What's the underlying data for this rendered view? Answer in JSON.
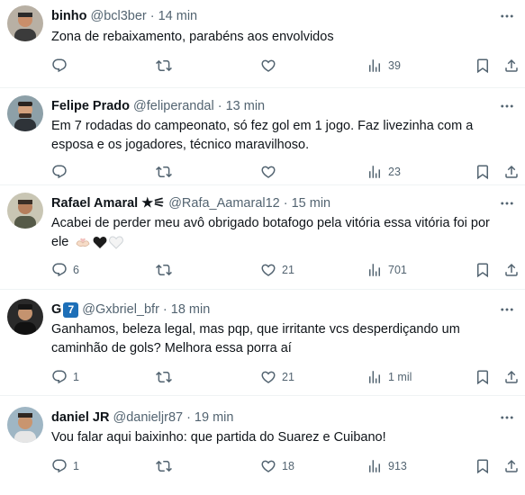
{
  "tweets": [
    {
      "display_name": "binho",
      "handle": "@bcl3ber",
      "separator": "·",
      "time": "14 min",
      "text": "Zona de rebaixamento, parabéns aos envolvidos",
      "replies": "",
      "retweets": "",
      "likes": "",
      "views": "39"
    },
    {
      "display_name": "Felipe Prado",
      "handle": "@feliperandal",
      "separator": "·",
      "time": "13 min",
      "text": "Em 7 rodadas do campeonato, só fez gol em 1 jogo. Faz livezinha com a esposa e os jogadores, técnico maravilhoso.",
      "replies": "",
      "retweets": "",
      "likes": "",
      "views": "23"
    },
    {
      "display_name": "Rafael Amaral ★⚟",
      "handle": "@Rafa_Aamaral12",
      "separator": "·",
      "time": "15 min",
      "text": "Acabei de perder meu avô obrigado botafogo pela vitória essa vitória foi por ele",
      "emojis": [
        "hands-heart",
        "black-heart",
        "white-heart"
      ],
      "replies": "6",
      "retweets": "",
      "likes": "21",
      "views": "701"
    },
    {
      "display_name": "G",
      "badge": "7",
      "badge_color": "#1d6fb8",
      "handle": "@Gxbriel_bfr",
      "separator": "·",
      "time": "18 min",
      "text": "Ganhamos, beleza legal, mas pqp, que irritante vcs desperdiçando um caminhão de gols? Melhora essa porra aí",
      "replies": "1",
      "retweets": "",
      "likes": "21",
      "views": "1 mil"
    },
    {
      "display_name": "daniel JR",
      "handle": "@danieljr87",
      "separator": "·",
      "time": "19 min",
      "text": "Vou falar aqui baixinho: que partida do Suarez e Cuibano!",
      "replies": "1",
      "retweets": "",
      "likes": "18",
      "views": "913"
    }
  ],
  "icons": {
    "reply": "reply-icon",
    "retweet": "retweet-icon",
    "like": "heart-icon",
    "views": "views-icon",
    "bookmark": "bookmark-icon",
    "share": "share-icon",
    "more": "more-icon"
  },
  "colors": {
    "text": "#0f1419",
    "secondary": "#536471",
    "divider": "#eff3f4"
  }
}
